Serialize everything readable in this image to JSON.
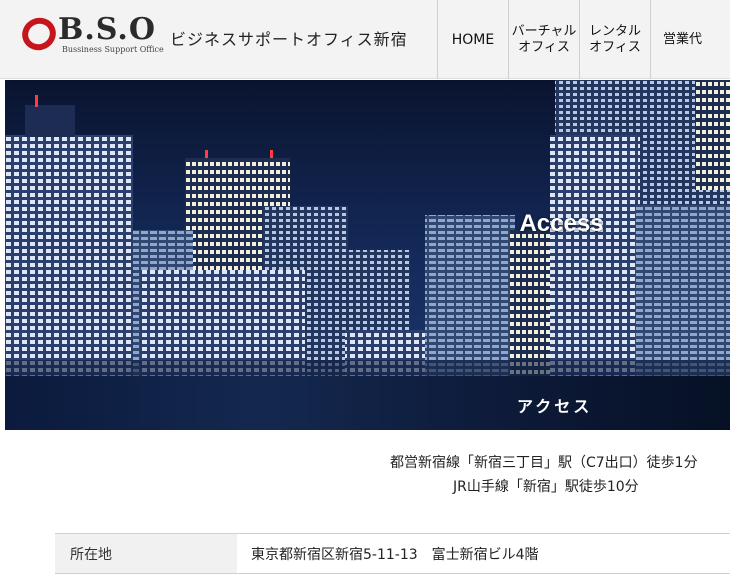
{
  "header": {
    "logo_text": "B.S.O",
    "logo_sub": "Bussiness Support Office",
    "site_name": "ビジネスサポートオフィス新宿",
    "nav": [
      {
        "label": "HOME"
      },
      {
        "label": "バーチャル\nオフィス"
      },
      {
        "label": "レンタル\nオフィス"
      },
      {
        "label": "営業代"
      }
    ]
  },
  "hero": {
    "title": "Access"
  },
  "section": {
    "title": "アクセス"
  },
  "directions": {
    "line1": "都営新宿線「新宿三丁目」駅（C7出口）徒歩1分",
    "line2": "JR山手線「新宿」駅徒歩10分"
  },
  "table": {
    "rows": [
      {
        "label": "所在地",
        "value": "東京都新宿区新宿5-11-13　富士新宿ビル4階"
      }
    ]
  },
  "colors": {
    "logo_red": "#c4161c",
    "hero_sky": "#0b1b3a",
    "section_bar": "#0d1a38"
  }
}
